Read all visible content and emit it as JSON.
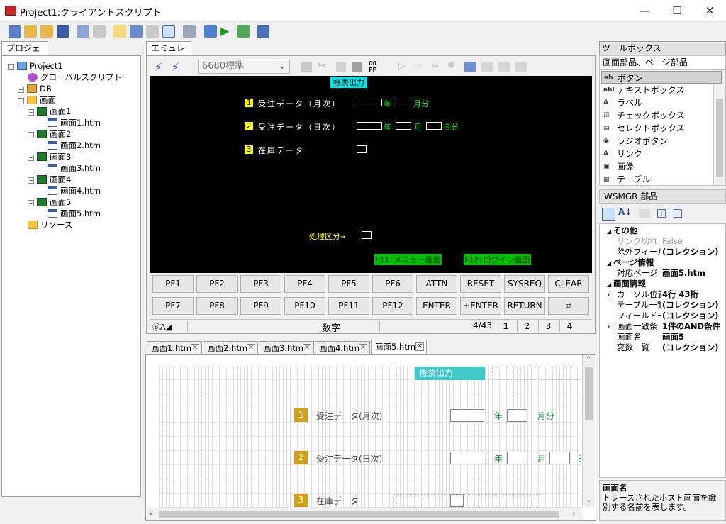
{
  "window": {
    "title": "Project1:クライアントスクリプト",
    "min": "—",
    "max": "☐",
    "close": "✕"
  },
  "project_panel": {
    "tab": "プロジェクト",
    "tree": [
      {
        "label": "Project1",
        "icon": "project-icon",
        "depth": 0,
        "exp": "−"
      },
      {
        "label": "グローバルスクリプト",
        "icon": "global-script-icon",
        "depth": 1,
        "exp": ""
      },
      {
        "label": "DB",
        "icon": "db-icon",
        "depth": 1,
        "exp": "+"
      },
      {
        "label": "画面",
        "icon": "folder-icon",
        "depth": 1,
        "exp": "−"
      },
      {
        "label": "画面1",
        "icon": "screen-icon",
        "depth": 2,
        "exp": "−"
      },
      {
        "label": "画面1.htm",
        "icon": "htm-icon",
        "depth": 3,
        "exp": ""
      },
      {
        "label": "画面2",
        "icon": "screen-icon",
        "depth": 2,
        "exp": "−"
      },
      {
        "label": "画面2.htm",
        "icon": "htm-icon",
        "depth": 3,
        "exp": ""
      },
      {
        "label": "画面3",
        "icon": "screen-icon",
        "depth": 2,
        "exp": "−"
      },
      {
        "label": "画面3.htm",
        "icon": "htm-icon",
        "depth": 3,
        "exp": ""
      },
      {
        "label": "画面4",
        "icon": "screen-icon",
        "depth": 2,
        "exp": "−"
      },
      {
        "label": "画面4.htm",
        "icon": "htm-icon",
        "depth": 3,
        "exp": ""
      },
      {
        "label": "画面5",
        "icon": "screen-icon",
        "depth": 2,
        "exp": "−"
      },
      {
        "label": "画面5.htm",
        "icon": "htm-icon",
        "depth": 3,
        "exp": ""
      },
      {
        "label": "リソース",
        "icon": "folder-icon",
        "depth": 1,
        "exp": ""
      }
    ]
  },
  "emulator": {
    "tab": "エミュレータ",
    "terminal_select": "6680標準",
    "screen": {
      "title": "帳票出力",
      "items": [
        {
          "num": "1",
          "label": "受注データ（月次）"
        },
        {
          "num": "2",
          "label": "受注データ（日次）"
        },
        {
          "num": "3",
          "label": "在庫データ"
        }
      ],
      "year": "年",
      "month_part": "月分",
      "month": "月",
      "day_part": "日分",
      "proc_label": "処理区分→",
      "pf11": "F11:メニュー画面",
      "pf12": "F12:ログイン画面"
    },
    "keys_row1": [
      "PF1",
      "PF2",
      "PF3",
      "PF4",
      "PF5",
      "PF6",
      "ATTN",
      "RESET",
      "SYSREQ",
      "CLEAR"
    ],
    "keys_row2": [
      "PF7",
      "PF8",
      "PF9",
      "PF10",
      "PF11",
      "PF12",
      "ENTER",
      "+ENTER",
      "RETURN"
    ],
    "status": {
      "mode": "ⒷA◢",
      "input": "数字",
      "pos": "4/43",
      "pages": [
        "1",
        "2",
        "3",
        "4"
      ]
    }
  },
  "doc_tabs": [
    "画面1.htm",
    "画面2.htm",
    "画面3.htm",
    "画面4.htm",
    "画面5.htm"
  ],
  "designer": {
    "title": "帳票出力",
    "rows": [
      {
        "num": "1",
        "label": "受注データ(月次)",
        "year": "年",
        "suffix": "月分"
      },
      {
        "num": "2",
        "label": "受注データ(日次)",
        "year": "年",
        "month": "月",
        "day": "日"
      },
      {
        "num": "3",
        "label": "在庫データ"
      }
    ]
  },
  "toolbox": {
    "header": "ツールボックス",
    "section": "画面部品、ページ部品",
    "items": [
      {
        "label": "ボタン",
        "icon": "button-icon",
        "selected": true
      },
      {
        "label": "テキストボックス",
        "icon": "textbox-icon"
      },
      {
        "label": "ラベル",
        "icon": "label-icon"
      },
      {
        "label": "チェックボックス",
        "icon": "checkbox-icon"
      },
      {
        "label": "セレクトボックス",
        "icon": "selectbox-icon"
      },
      {
        "label": "ラジオボタン",
        "icon": "radio-icon"
      },
      {
        "label": "リンク",
        "icon": "link-icon"
      },
      {
        "label": "画像",
        "icon": "image-icon"
      },
      {
        "label": "テーブル",
        "icon": "table-icon"
      }
    ],
    "wsmgr": "WSMGR 部品"
  },
  "properties": {
    "groups": [
      {
        "name": "その他",
        "rows": [
          {
            "k": "リンク切れ",
            "v": "False",
            "grey": true
          },
          {
            "k": "除外フィール",
            "v": "(コレクション)"
          }
        ]
      },
      {
        "name": "ページ情報",
        "rows": [
          {
            "k": "対応ページ",
            "v": "画面5.htm"
          }
        ]
      },
      {
        "name": "画面情報",
        "rows": [
          {
            "k": "カーソル位置",
            "v": "4行 43桁",
            "exp": true
          },
          {
            "k": "テーブル一覧",
            "v": "(コレクション)"
          },
          {
            "k": "フィールド一覧",
            "v": "(コレクション)"
          },
          {
            "k": "画面一致条",
            "v": "1件のAND条件",
            "exp": true
          },
          {
            "k": "画面名",
            "v": "画面5"
          },
          {
            "k": "変数一覧",
            "v": "(コレクション)"
          }
        ]
      }
    ],
    "desc_title": "画面名",
    "desc_text": "トレースされたホスト画面を識別する名前を表します。"
  },
  "colors": {
    "term_bg": "#000000",
    "term_yellow": "#ffff00",
    "term_green": "#00ff00",
    "term_title": "#00e5e5",
    "designer_title": "#3ec8c8",
    "designer_num": "#d4a017"
  }
}
